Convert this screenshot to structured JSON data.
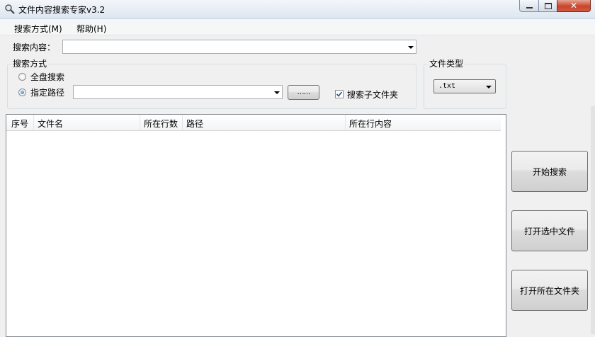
{
  "window": {
    "title": "文件内容搜索专家v3.2",
    "app_icon": "search-magnifier-icon",
    "controls": [
      "minimize-icon",
      "maximize-icon",
      "close-icon"
    ]
  },
  "menu": {
    "items": [
      {
        "label": "搜索方式(M)"
      },
      {
        "label": "帮助(H)"
      }
    ]
  },
  "search": {
    "content_label": "搜索内容：",
    "content_value": ""
  },
  "search_mode": {
    "group_title": "搜索方式",
    "option_full_disk": "全盘搜索",
    "option_path": "指定路径",
    "selected": "指定路径",
    "path_value": "",
    "browse_label": "……",
    "subfolder_label": "搜索子文件夹",
    "subfolder_checked": true
  },
  "file_type": {
    "group_title": "文件类型",
    "selected": ".txt"
  },
  "results": {
    "columns": [
      "序号",
      "文件名",
      "所在行数",
      "路径",
      "所在行内容"
    ],
    "rows": []
  },
  "actions": {
    "start_search": "开始搜索",
    "open_selected": "打开选中文件",
    "open_folder": "打开所在文件夹"
  },
  "colors": {
    "close_button": "#c8452c",
    "radio_dot": "#1f6fc2",
    "window_bg": "#f0f0f0"
  }
}
